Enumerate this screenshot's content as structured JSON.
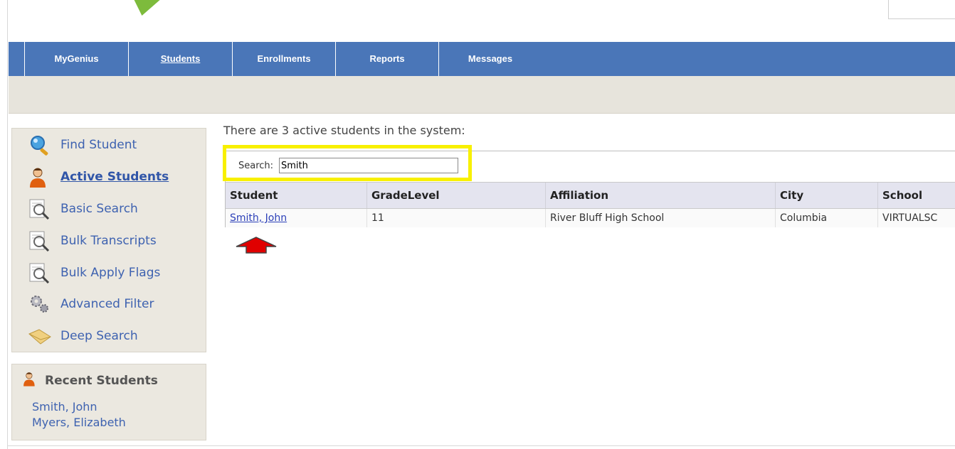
{
  "nav": {
    "items": [
      {
        "label": "MyGenius",
        "active": false
      },
      {
        "label": "Students",
        "active": true
      },
      {
        "label": "Enrollments",
        "active": false
      },
      {
        "label": "Reports",
        "active": false
      },
      {
        "label": "Messages",
        "active": false
      }
    ]
  },
  "sidebar": {
    "items": [
      {
        "label": "Find Student",
        "icon": "magnifier-icon",
        "active": false
      },
      {
        "label": "Active Students",
        "icon": "student-icon",
        "active": true
      },
      {
        "label": "Basic Search",
        "icon": "document-search-icon",
        "active": false
      },
      {
        "label": "Bulk Transcripts",
        "icon": "document-search-icon",
        "active": false
      },
      {
        "label": "Bulk Apply Flags",
        "icon": "document-search-icon",
        "active": false
      },
      {
        "label": "Advanced Filter",
        "icon": "gears-icon",
        "active": false
      },
      {
        "label": "Deep Search",
        "icon": "folder-icon",
        "active": false
      }
    ]
  },
  "recent": {
    "title": "Recent Students",
    "students": [
      "Smith, John",
      "Myers, Elizabeth"
    ]
  },
  "main": {
    "summary": "There are 3 active students in the system:",
    "search": {
      "label": "Search:",
      "value": "Smith"
    },
    "columns": [
      "Student",
      "GradeLevel",
      "Affiliation",
      "City",
      "School"
    ],
    "rows": [
      {
        "student": "Smith, John",
        "grade": "11",
        "affiliation": "River Bluff High School",
        "city": "Columbia",
        "school": "VIRTUALSC"
      }
    ]
  },
  "colors": {
    "nav_bg": "#4a76b8",
    "highlight": "#f8f000",
    "arrow": "#e00000",
    "link": "#3e62b0"
  }
}
